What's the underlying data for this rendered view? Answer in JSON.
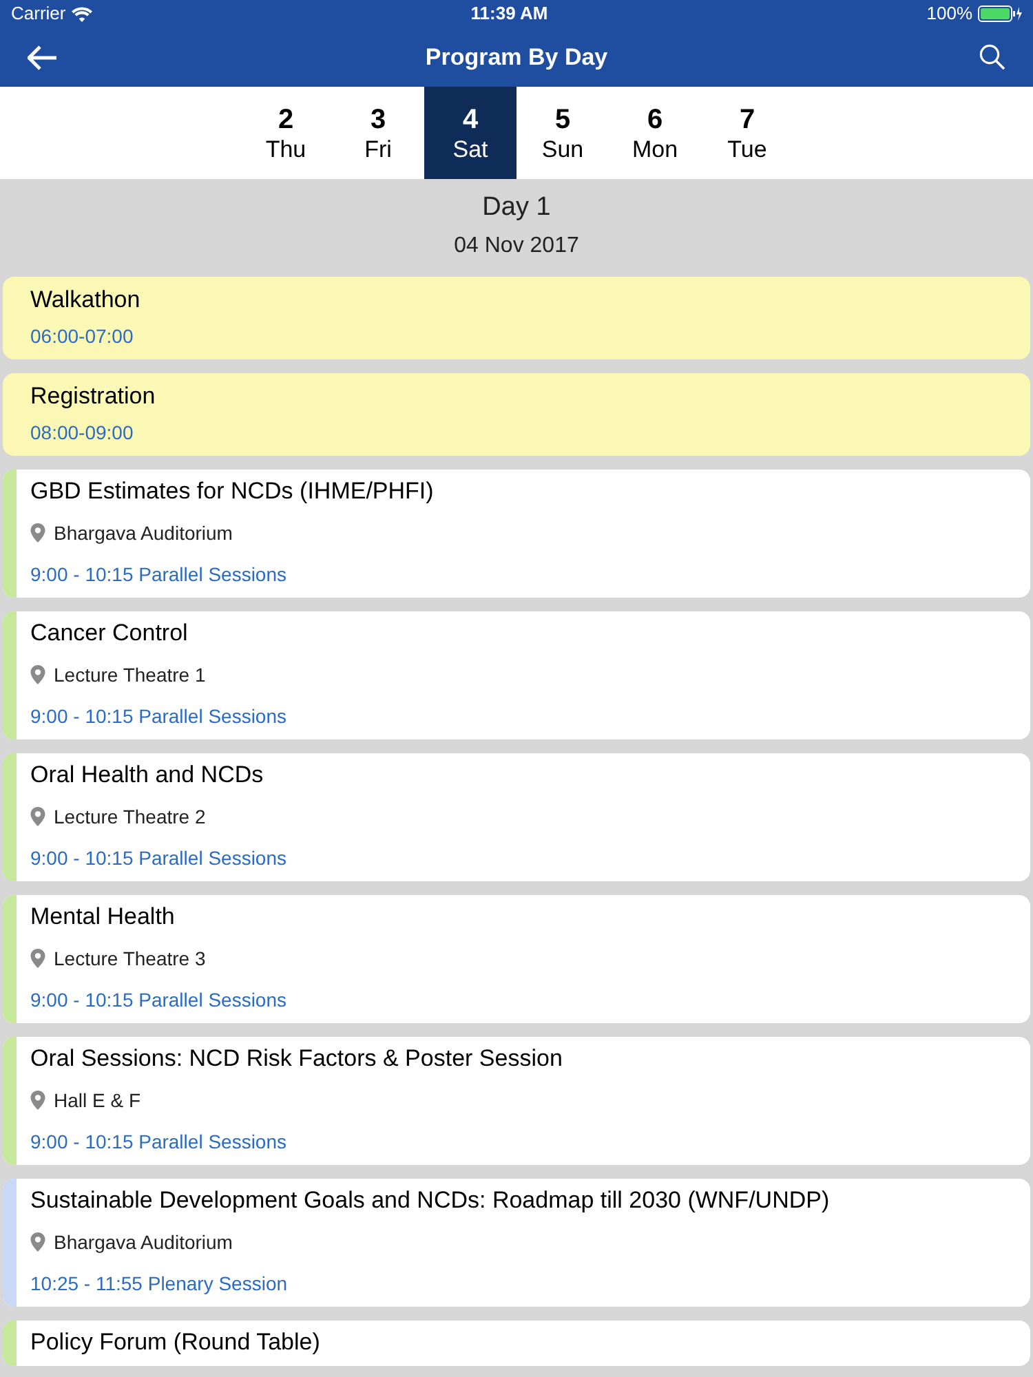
{
  "status_bar": {
    "carrier": "Carrier",
    "time": "11:39 AM",
    "battery": "100%"
  },
  "nav": {
    "title": "Program By Day"
  },
  "days": [
    {
      "number": "2",
      "weekday": "Thu",
      "selected": false
    },
    {
      "number": "3",
      "weekday": "Fri",
      "selected": false
    },
    {
      "number": "4",
      "weekday": "Sat",
      "selected": true
    },
    {
      "number": "5",
      "weekday": "Sun",
      "selected": false
    },
    {
      "number": "6",
      "weekday": "Mon",
      "selected": false
    },
    {
      "number": "7",
      "weekday": "Tue",
      "selected": false
    }
  ],
  "day_header": {
    "title": "Day 1",
    "date": "04 Nov 2017"
  },
  "events": [
    {
      "kind": "highlight",
      "title": "Walkathon",
      "time": "06:00-07:00"
    },
    {
      "kind": "highlight",
      "title": "Registration",
      "time": "08:00-09:00"
    },
    {
      "kind": "session",
      "color": "#c5e89a",
      "title": "GBD Estimates for NCDs (IHME/PHFI)",
      "location": "Bhargava Auditorium",
      "time": "9:00 - 10:15 Parallel Sessions"
    },
    {
      "kind": "session",
      "color": "#c5e89a",
      "title": "Cancer Control",
      "location": "Lecture Theatre 1",
      "time": "9:00 - 10:15 Parallel Sessions"
    },
    {
      "kind": "session",
      "color": "#c5e89a",
      "title": "Oral Health and NCDs",
      "location": "Lecture Theatre 2",
      "time": "9:00 - 10:15 Parallel Sessions"
    },
    {
      "kind": "session",
      "color": "#c5e89a",
      "title": "Mental Health",
      "location": "Lecture Theatre 3",
      "time": "9:00 - 10:15 Parallel Sessions"
    },
    {
      "kind": "session",
      "color": "#c5e89a",
      "title": "Oral Sessions: NCD Risk Factors & Poster Session",
      "location": "Hall E & F",
      "time": "9:00 - 10:15 Parallel Sessions"
    },
    {
      "kind": "session",
      "color": "#c8d8f5",
      "title": "Sustainable Development Goals and NCDs: Roadmap till 2030 (WNF/UNDP)",
      "location": "Bhargava Auditorium",
      "time": "10:25 - 11:55 Plenary Session"
    },
    {
      "kind": "session",
      "color": "#c5e89a",
      "title": "Policy Forum (Round Table)"
    }
  ]
}
